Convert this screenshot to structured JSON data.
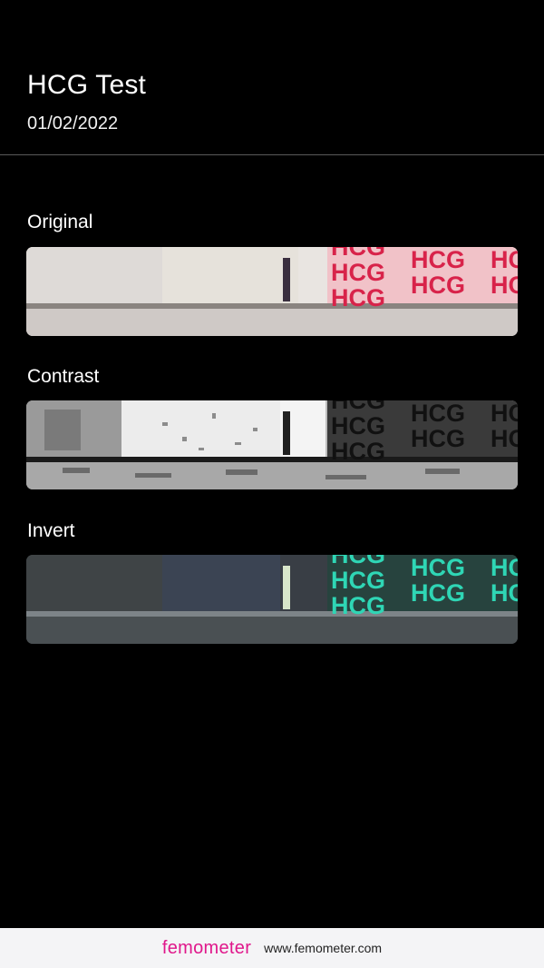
{
  "header": {
    "title": "HCG Test",
    "date": "01/02/2022"
  },
  "sections": [
    {
      "label": "Original",
      "strip_text": "HCG"
    },
    {
      "label": "Contrast",
      "strip_text": "HCG"
    },
    {
      "label": "Invert",
      "strip_text": "HCG"
    }
  ],
  "footer": {
    "brand": "femometer",
    "url": "www.femometer.com"
  },
  "colors": {
    "background": "#000000",
    "brand": "#e0178b",
    "hcg_original": "#d8234a",
    "hcg_contrast": "#111111",
    "hcg_invert": "#2fd6b5"
  }
}
